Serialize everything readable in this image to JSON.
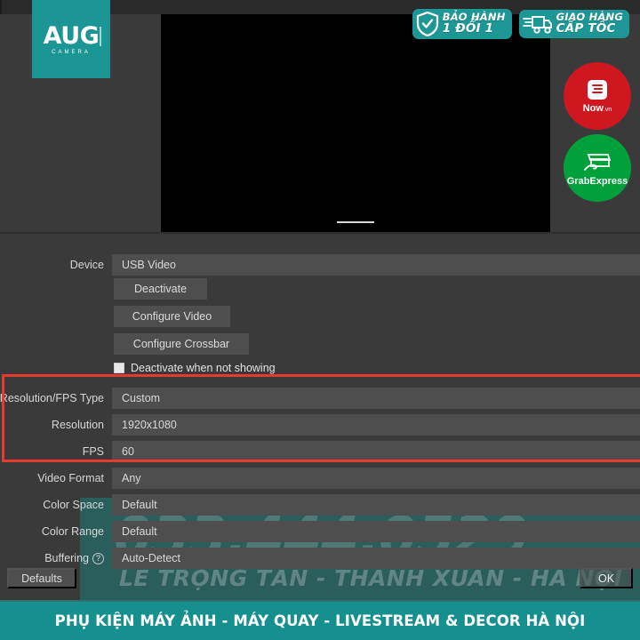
{
  "brand": {
    "logo_main": "AUG",
    "logo_sub": "CAMERA"
  },
  "promo_badges": [
    {
      "icon": "shield-check-icon",
      "line1": "BẢO HÀNH",
      "line2": "1 ĐỔI 1"
    },
    {
      "icon": "delivery-truck-icon",
      "line1": "GIAO HÀNG",
      "line2": "CẤP TỐC"
    }
  ],
  "service_circles": [
    {
      "icon": "now-receipt-icon",
      "label": "Now",
      "tld": ".vn",
      "color": "#cf1720"
    },
    {
      "icon": "grab-parcel-hand-icon",
      "label": "GrabExpress",
      "color": "#00a13a"
    }
  ],
  "preview": {
    "name": "video-preview"
  },
  "form": {
    "device": {
      "label": "Device",
      "value": "USB Video"
    },
    "buttons": {
      "deactivate": "Deactivate",
      "configure_video": "Configure Video",
      "configure_crossbar": "Configure Crossbar"
    },
    "checkbox": {
      "label": "Deactivate when not showing",
      "checked": false
    },
    "rows": [
      {
        "label": "Resolution/FPS Type",
        "value": "Custom",
        "highlighted": true
      },
      {
        "label": "Resolution",
        "value": "1920x1080",
        "highlighted": true
      },
      {
        "label": "FPS",
        "value": "60",
        "highlighted": true
      },
      {
        "label": "Video Format",
        "value": "Any",
        "highlighted": false
      },
      {
        "label": "Color Space",
        "value": "Default",
        "highlighted": false
      },
      {
        "label": "Color Range",
        "value": "Default",
        "highlighted": false
      },
      {
        "label": "Buffering",
        "value": "Auto-Detect",
        "highlighted": false,
        "help": "?"
      }
    ],
    "defaults_button": "Defaults",
    "ok_button": "OK"
  },
  "highlight": {
    "color": "#e8392f"
  },
  "watermark": {
    "phone": "033.444.0529",
    "address": "LÊ TRỌNG TẤN - THANH XUÂN - HÀ NỘI"
  },
  "footer": {
    "text": "PHỤ KIỆN MÁY ẢNH - MÁY QUAY - LIVESTREAM & DECOR HÀ NỘI",
    "color": "#16908f"
  }
}
